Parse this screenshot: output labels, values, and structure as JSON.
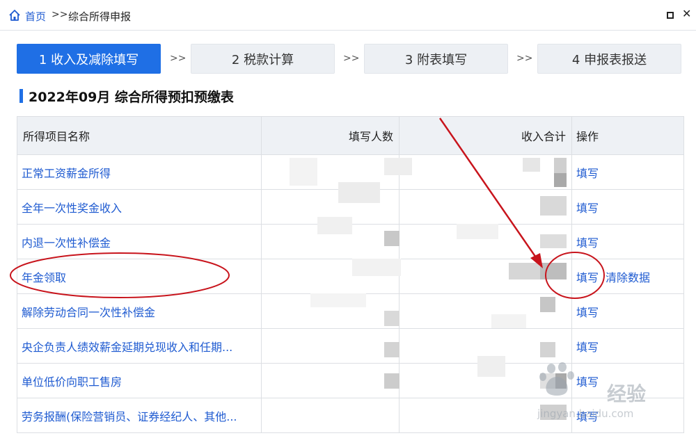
{
  "breadcrumb": {
    "home": "首页",
    "separator": ">>",
    "current": "综合所得申报"
  },
  "steps": [
    {
      "label": "1 收入及减除填写",
      "active": true
    },
    {
      "label": "2 税款计算",
      "active": false
    },
    {
      "label": "3 附表填写",
      "active": false
    },
    {
      "label": "4 申报表报送",
      "active": false
    }
  ],
  "step_arrow": ">>",
  "section_title": "2022年09月  综合所得预扣预缴表",
  "table": {
    "headers": {
      "name": "所得项目名称",
      "count": "填写人数",
      "total": "收入合计",
      "op": "操作"
    },
    "rows": [
      {
        "name": "正常工资薪金所得",
        "ops": [
          "填写"
        ]
      },
      {
        "name": "全年一次性奖金收入",
        "ops": [
          "填写"
        ]
      },
      {
        "name": "内退一次性补偿金",
        "ops": [
          "填写"
        ]
      },
      {
        "name": "年金领取",
        "ops": [
          "填写",
          "清除数据"
        ]
      },
      {
        "name": "解除劳动合同一次性补偿金",
        "ops": [
          "填写"
        ]
      },
      {
        "name": "央企负责人绩效薪金延期兑现收入和任期...",
        "ops": [
          "填写"
        ]
      },
      {
        "name": "单位低价向职工售房",
        "ops": [
          "填写"
        ]
      },
      {
        "name": "劳务报酬(保险营销员、证券经纪人、其他...",
        "ops": [
          "填写"
        ]
      }
    ]
  },
  "watermark": {
    "text": "经验",
    "sub": "jingyan.baidu.com"
  },
  "colors": {
    "accent": "#1f6fe5",
    "link": "#1f5bd1",
    "annotation": "#c8141c"
  },
  "icons": {
    "home": "home-icon",
    "maximize": "maximize-icon",
    "close": "close-icon"
  }
}
